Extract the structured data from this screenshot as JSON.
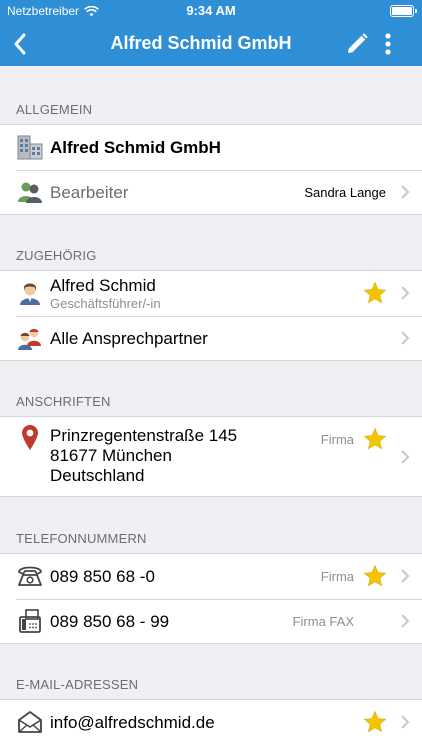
{
  "status": {
    "carrier": "Netzbetreiber",
    "time": "9:34 AM"
  },
  "nav": {
    "title": "Alfred Schmid GmbH"
  },
  "sections": {
    "allgemein": "ALLGEMEIN",
    "zugehoerig": "ZUGEHÖRIG",
    "anschriften": "ANSCHRIFTEN",
    "telefon": "TELEFONNUMMERN",
    "email": "E-MAIL-ADRESSEN"
  },
  "general": {
    "company": "Alfred Schmid GmbH",
    "editor_label": "Bearbeiter",
    "editor_value": "Sandra Lange"
  },
  "related": {
    "person_name": "Alfred Schmid",
    "person_role": "Geschäftsführer/-in",
    "all_contacts": "Alle Ansprechpartner"
  },
  "address": {
    "line1": "Prinzregentenstraße 145",
    "line2": "81677 München",
    "line3": "Deutschland",
    "type": "Firma"
  },
  "phones": [
    {
      "number": "089 850 68 -0",
      "type": "Firma"
    },
    {
      "number": "089 850 68 - 99",
      "type": "Firma FAX"
    }
  ],
  "email": {
    "address": "info@alfredschmid.de"
  },
  "colors": {
    "header": "#2e8fd6",
    "star": "#f5c400",
    "pin": "#c0392b",
    "background": "#efeff4"
  }
}
